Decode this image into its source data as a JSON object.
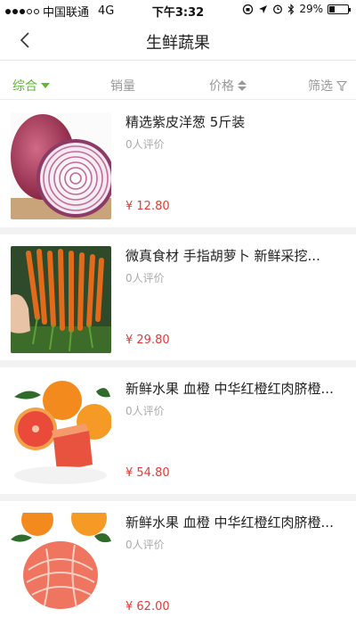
{
  "status": {
    "carrier": "中国联通",
    "network": "4G",
    "time": "下午3:32",
    "battery": "29%",
    "battery_level": 0.29
  },
  "nav": {
    "title": "生鲜蔬果",
    "back_icon": "chevron-left-icon"
  },
  "filters": {
    "comprehensive": "综合",
    "sales": "销量",
    "price": "价格",
    "filter": "筛选",
    "active_color": "#5fb832"
  },
  "products": [
    {
      "title": "精选紫皮洋葱 5斤装",
      "reviews": "0人评价",
      "price": "¥ 12.80"
    },
    {
      "title": "微真食材 手指胡萝卜  新鲜采挖...",
      "reviews": "0人评价",
      "price": "¥ 29.80"
    },
    {
      "title": "新鲜水果 血橙 中华红橙红肉脐橙...",
      "reviews": "0人评价",
      "price": "¥ 54.80"
    },
    {
      "title": "新鲜水果 血橙 中华红橙红肉脐橙...",
      "reviews": "0人评价",
      "price": "¥ 62.00"
    }
  ],
  "price_color": "#e53935"
}
